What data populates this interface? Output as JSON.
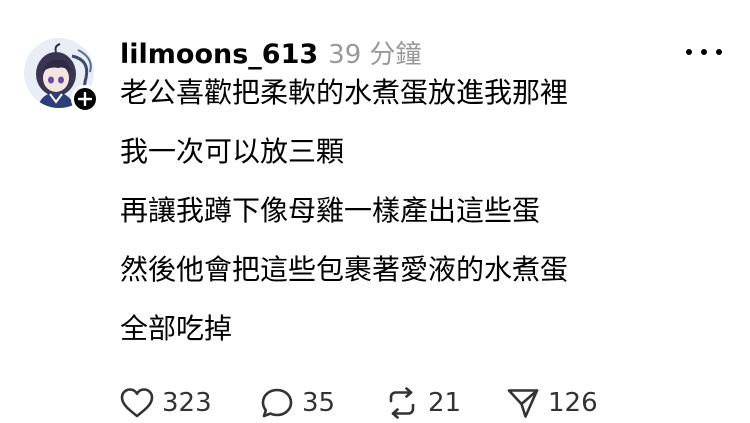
{
  "post": {
    "author": {
      "username": "lilmoons_613",
      "avatar_icon": "anime-character-avatar",
      "follow_icon": "plus-icon"
    },
    "timestamp": "39 分鐘",
    "more_icon": "more-horizontal-icon",
    "lines": [
      "老公喜歡把柔軟的水煮蛋放進我那裡",
      "我一次可以放三顆",
      "再讓我蹲下像母雞一樣產出這些蛋",
      "然後他會把這些包裹著愛液的水煮蛋",
      "全部吃掉"
    ],
    "actions": {
      "like": {
        "icon": "heart-icon",
        "count": "323"
      },
      "comment": {
        "icon": "comment-bubble-icon",
        "count": "35"
      },
      "repost": {
        "icon": "repost-icon",
        "count": "21"
      },
      "share": {
        "icon": "send-icon",
        "count": "126"
      }
    }
  },
  "colors": {
    "text": "#000000",
    "muted": "#999999",
    "count": "#333333",
    "background": "#ffffff"
  }
}
